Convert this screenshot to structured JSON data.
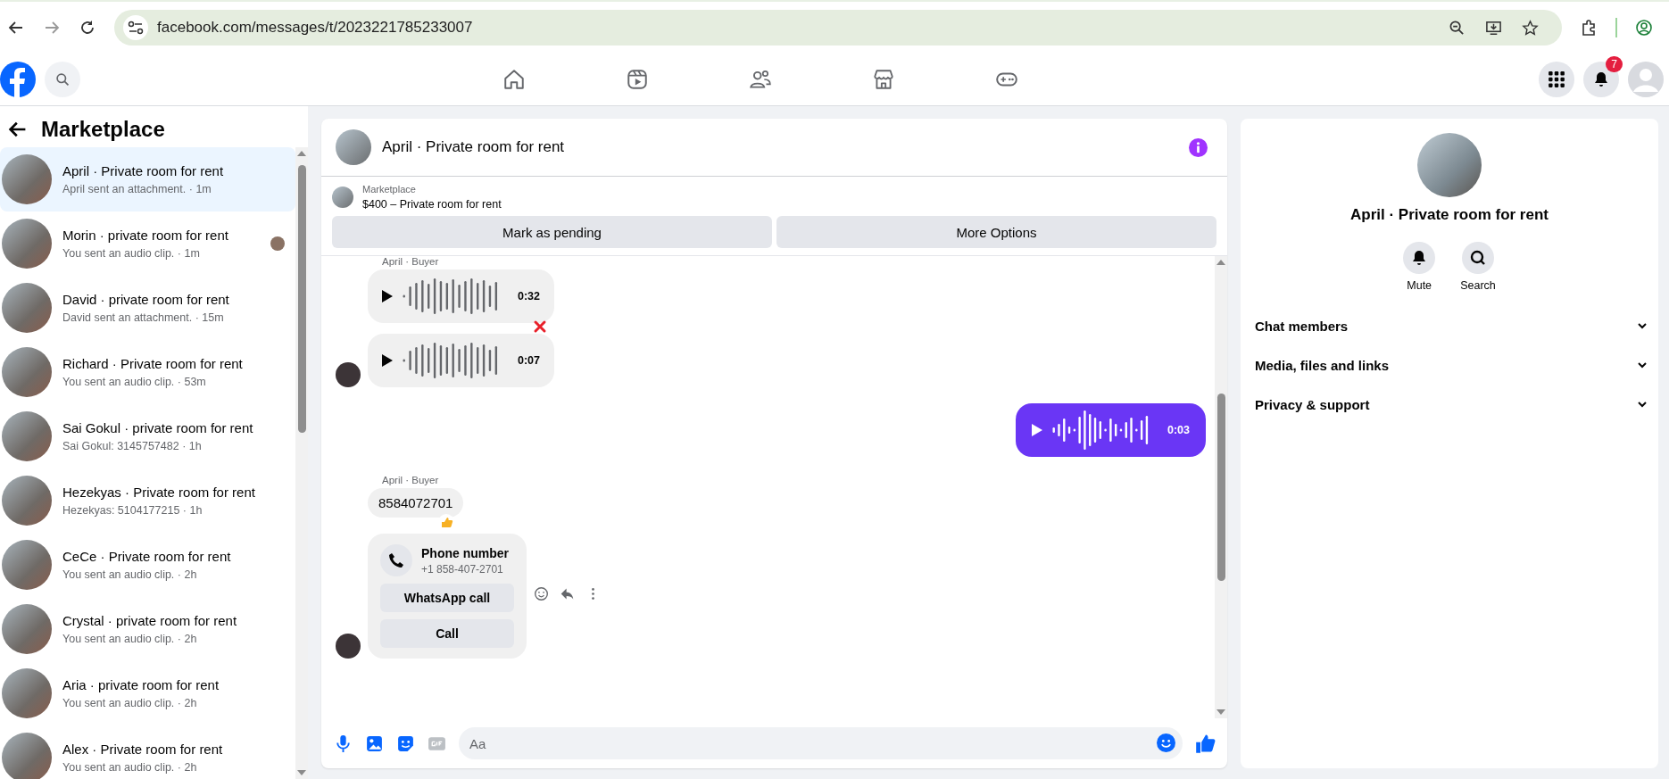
{
  "browser": {
    "url": "facebook.com/messages/t/2023221785233007"
  },
  "nav": {
    "notification_count": "7"
  },
  "sidebar": {
    "title": "Marketplace",
    "conversations": [
      {
        "title": "April · Private room for rent",
        "preview": "April sent an attachment. · 1m",
        "selected": true,
        "seen": false
      },
      {
        "title": "Morin · private room for rent",
        "preview": "You sent an audio clip. · 1m",
        "selected": false,
        "seen": true
      },
      {
        "title": "David · private room for rent",
        "preview": "David sent an attachment. · 15m",
        "selected": false,
        "seen": false
      },
      {
        "title": "Richard · Private room for rent",
        "preview": "You sent an audio clip. · 53m",
        "selected": false,
        "seen": false
      },
      {
        "title": "Sai Gokul · private room for rent",
        "preview": "Sai Gokul: 3145757482 · 1h",
        "selected": false,
        "seen": false
      },
      {
        "title": "Hezekyas · Private room for rent",
        "preview": "Hezekyas: 5104177215 · 1h",
        "selected": false,
        "seen": false
      },
      {
        "title": "CeCe · Private room for rent",
        "preview": "You sent an audio clip. · 2h",
        "selected": false,
        "seen": false
      },
      {
        "title": "Crystal · private room for rent",
        "preview": "You sent an audio clip. · 2h",
        "selected": false,
        "seen": false
      },
      {
        "title": "Aria · private room for rent",
        "preview": "You sent an audio clip. · 2h",
        "selected": false,
        "seen": false
      },
      {
        "title": "Alex · Private room for rent",
        "preview": "You sent an audio clip. · 2h",
        "selected": false,
        "seen": false
      }
    ]
  },
  "chat": {
    "title": "April · Private room for rent",
    "listing": {
      "source": "Marketplace",
      "item": "$400 – Private room for rent"
    },
    "actions": [
      "Mark as pending",
      "More Options"
    ],
    "messages": [
      {
        "kind": "audio",
        "sender": "April · Buyer",
        "duration": "0:32",
        "outgoing": false,
        "cross_reaction": true
      },
      {
        "kind": "audio",
        "duration": "0:07",
        "outgoing": false,
        "avatar": true
      },
      {
        "kind": "audio",
        "duration": "0:03",
        "outgoing": true
      },
      {
        "kind": "text",
        "sender": "April · Buyer",
        "text": "8584072701",
        "thumbs_up_reaction": true
      },
      {
        "kind": "phone_card",
        "title": "Phone number",
        "number": "+1 858-407-2701",
        "buttons": [
          "WhatsApp call",
          "Call"
        ],
        "avatar": true,
        "hover_actions": true
      }
    ],
    "composer": {
      "placeholder": "Aa"
    }
  },
  "details": {
    "title": "April · Private room for rent",
    "actions": [
      {
        "label": "Mute",
        "kind": "bell"
      },
      {
        "label": "Search",
        "kind": "search"
      }
    ],
    "sections": [
      {
        "label": "Chat members",
        "expanded": false
      },
      {
        "label": "Media, files and links",
        "expanded": false
      },
      {
        "label": "Privacy & support",
        "expanded": false
      }
    ]
  }
}
